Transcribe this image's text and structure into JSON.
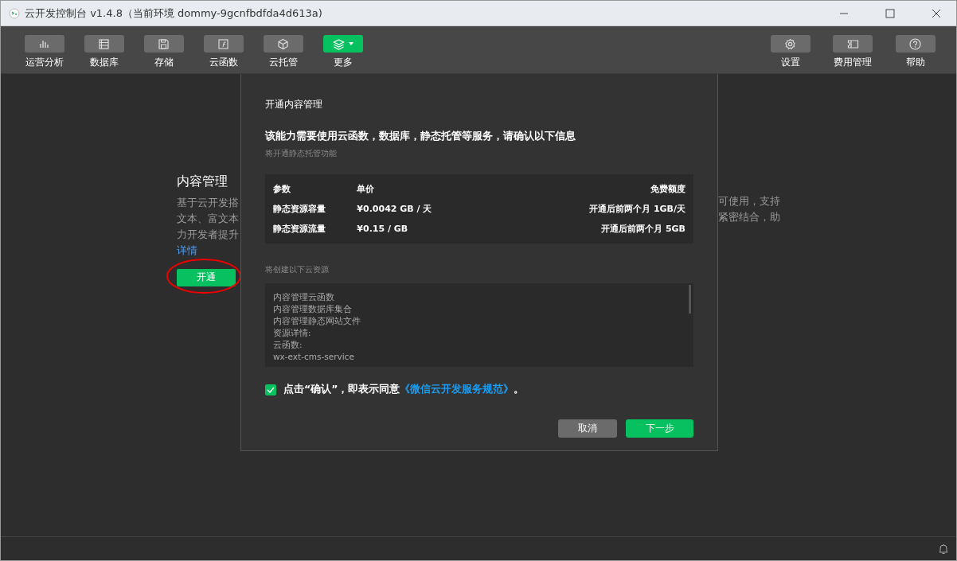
{
  "window": {
    "title": "云开发控制台 v1.4.8（当前环境 dommy-9gcnfbdfda4d613a)"
  },
  "toolbar": {
    "left": [
      {
        "label": "运营分析",
        "selected": false,
        "dropdown": false
      },
      {
        "label": "数据库",
        "selected": false,
        "dropdown": false
      },
      {
        "label": "存储",
        "selected": false,
        "dropdown": false
      },
      {
        "label": "云函数",
        "selected": false,
        "dropdown": false
      },
      {
        "label": "云托管",
        "selected": false,
        "dropdown": false
      },
      {
        "label": "更多",
        "selected": true,
        "dropdown": true
      }
    ],
    "right": [
      {
        "label": "设置",
        "selected": false,
        "dropdown": false
      },
      {
        "label": "费用管理",
        "selected": false,
        "dropdown": false
      },
      {
        "label": "帮助",
        "selected": false,
        "dropdown": false
      }
    ]
  },
  "feature": {
    "title": "内容管理",
    "description_left": [
      "基于云开发搭",
      "文本、富文本",
      "力开发者提升"
    ],
    "description_right": [
      "可使用，支持",
      "紧密结合，助"
    ],
    "link": "详情",
    "button": "开通",
    "annotated": true
  },
  "dialog": {
    "title": "开通内容管理",
    "headline": "该能力需要使用云函数，数据库，静态托管等服务，请确认以下信息",
    "subtitle": "将开通静态托管功能",
    "table": {
      "columns": [
        "参数",
        "单价",
        "免费额度"
      ],
      "rows": [
        [
          "静态资源容量",
          "¥0.0042 GB / 天",
          "开通后前两个月 1GB/天"
        ],
        [
          "静态资源流量",
          "¥0.15 / GB",
          "开通后前两个月 5GB"
        ]
      ]
    },
    "resources_label": "将创建以下云资源",
    "resources": [
      "内容管理云函数",
      "内容管理数据库集合",
      "内容管理静态网站文件",
      "资源详情:",
      "云函数:",
      "wx-ext-cms-service"
    ],
    "agreement": {
      "checked": true,
      "text": "点击“确认”，即表示同意",
      "link": "《微信云开发服务规范》",
      "suffix": "。"
    },
    "buttons": [
      {
        "label": "取消",
        "kind": "secondary"
      },
      {
        "label": "下一步",
        "kind": "primary"
      }
    ]
  }
}
